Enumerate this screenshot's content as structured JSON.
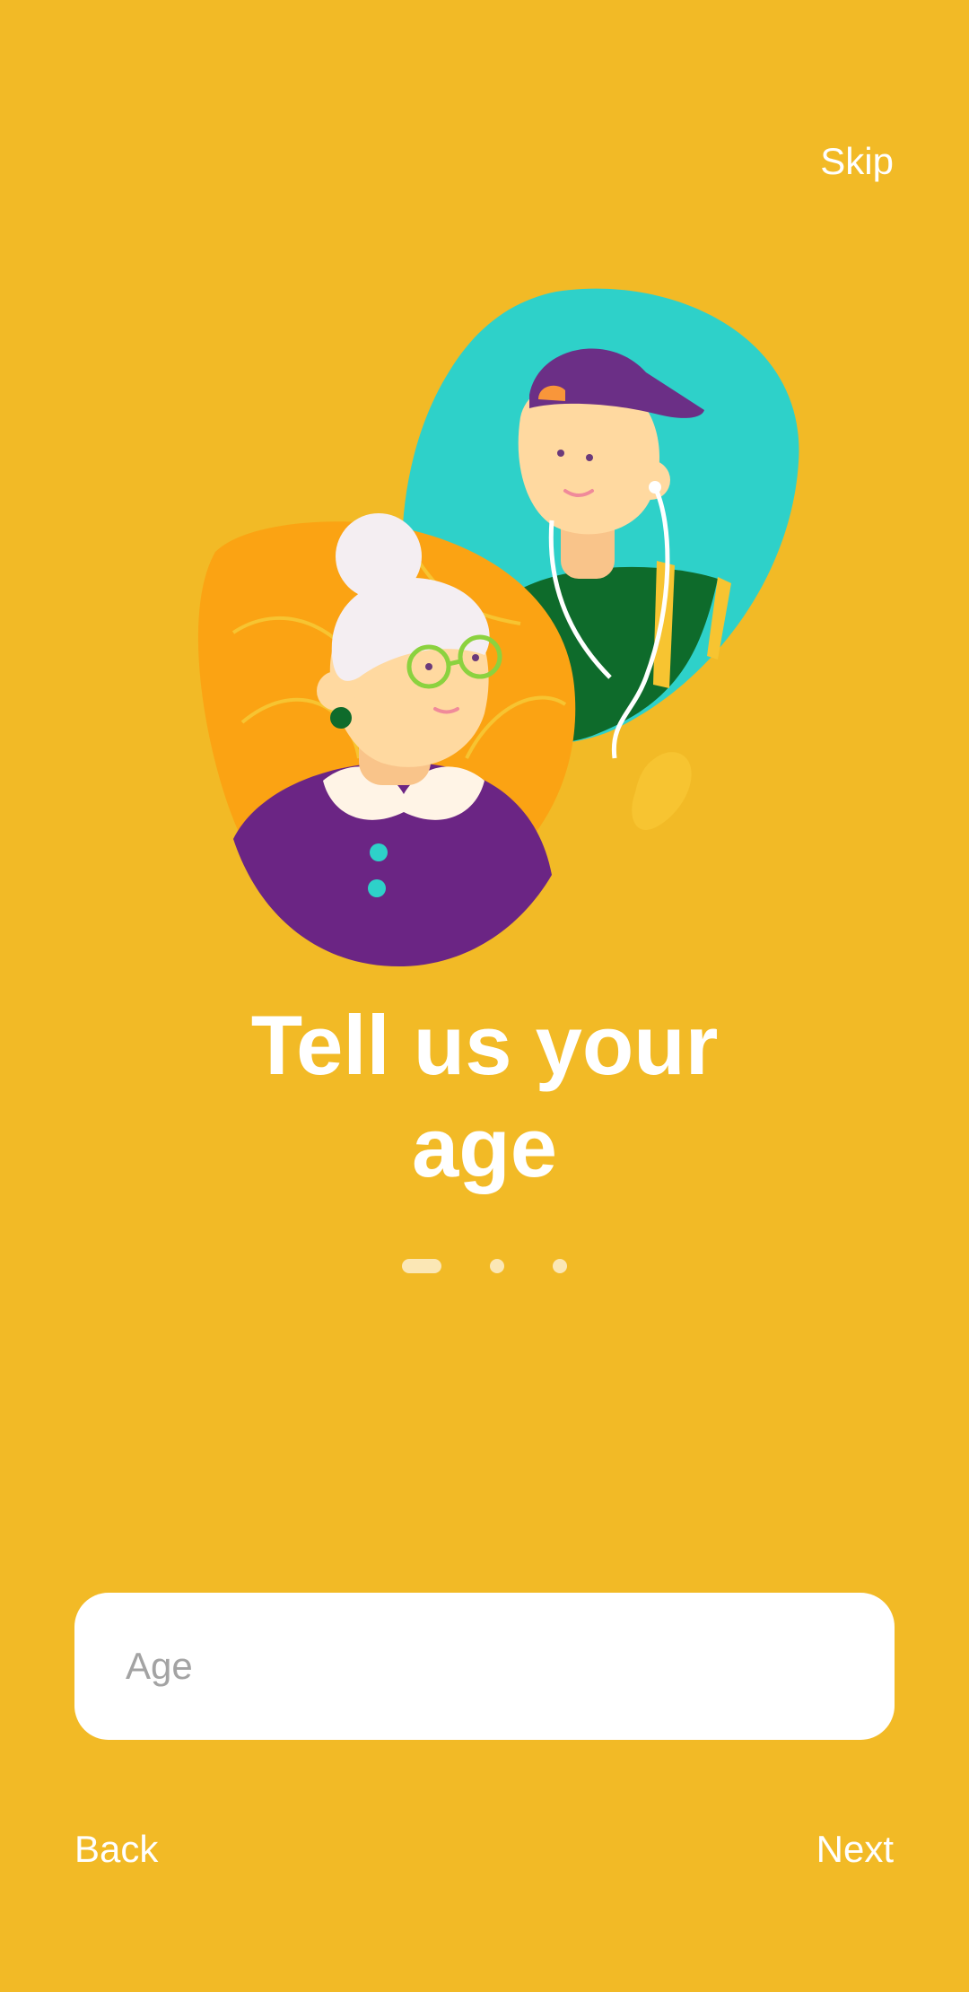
{
  "header": {
    "skip_label": "Skip"
  },
  "onboarding": {
    "title_line1": "Tell us your",
    "title_line2": "age",
    "page_indicator": {
      "total": 3,
      "active_index": 0
    }
  },
  "form": {
    "age_placeholder": "Age",
    "age_value": ""
  },
  "footer": {
    "back_label": "Back",
    "next_label": "Next"
  },
  "colors": {
    "background": "#F2BA26",
    "text": "#FFFFFF",
    "field_background": "#FFFFFF",
    "placeholder": "#A3A3A3",
    "indicator": "#FBE7B5"
  }
}
